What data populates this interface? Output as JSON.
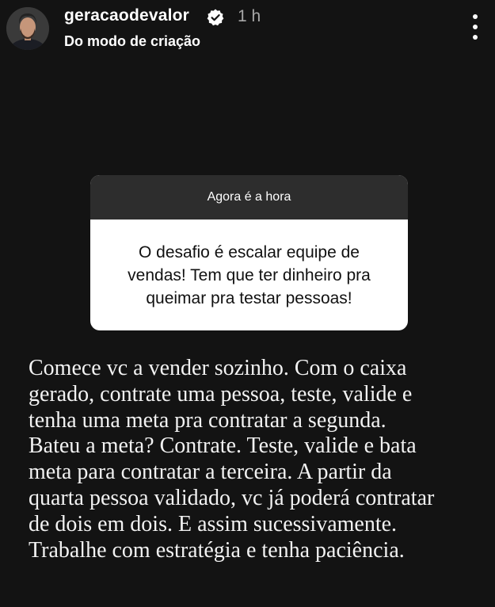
{
  "header": {
    "username": "geracaodevalor",
    "time": "1 h",
    "subtitle": "Do modo de criação"
  },
  "question_box": {
    "title": "Agora é a hora",
    "question_lines": [
      "O desafio é escalar equipe de",
      "vendas! Tem que ter dinheiro pra",
      "queimar pra testar pessoas!"
    ]
  },
  "answer": {
    "lines": [
      "Comece vc a vender sozinho. Com o caixa",
      "gerado, contrate uma pessoa, teste, valide e",
      "tenha uma meta pra contratar a segunda.",
      "Bateu a meta? Contrate. Teste, valide e bata",
      "meta para contratar a terceira. A partir da",
      "quarta pessoa validado, vc já poderá contratar",
      "de dois em dois. E assim sucessivamente.",
      "Trabalhe com estratégia e tenha paciência."
    ]
  },
  "icons": {
    "verified": "verified-badge-icon",
    "more": "more-options-icon"
  },
  "colors": {
    "background": "#131313",
    "question_header": "#2d2d2d",
    "question_body": "#ffffff",
    "muted_text": "#a8a8a8"
  }
}
